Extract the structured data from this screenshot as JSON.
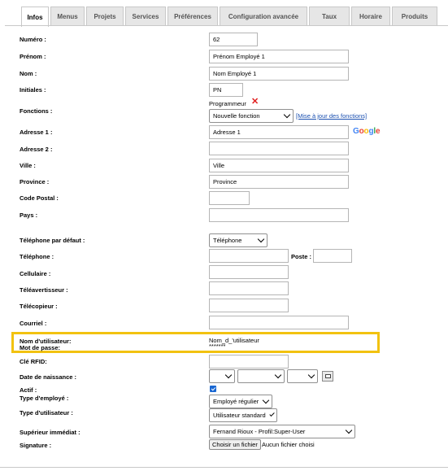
{
  "tabs": [
    {
      "label": "Infos",
      "active": true
    },
    {
      "label": "Menus"
    },
    {
      "label": "Projets"
    },
    {
      "label": "Services"
    },
    {
      "label": "Préférences"
    },
    {
      "label": "Configuration avancée"
    },
    {
      "label": "Taux"
    },
    {
      "label": "Horaire"
    },
    {
      "label": "Produits"
    }
  ],
  "labels": {
    "numero": "Numéro :",
    "prenom": "Prénom :",
    "nom": "Nom :",
    "initiales": "Initiales :",
    "fonctions": "Fonctions :",
    "adresse1": "Adresse 1 :",
    "adresse2": "Adresse 2 :",
    "ville": "Ville :",
    "province": "Province :",
    "code_postal": "Code Postal :",
    "pays": "Pays :",
    "telephone_defaut": "Téléphone par défaut :",
    "telephone": "Téléphone :",
    "poste": "Poste :",
    "cellulaire": "Cellulaire :",
    "teleavertisseur": "Téléavertisseur :",
    "telecopieur": "Télécopieur :",
    "courriel": "Courriel :",
    "nom_utilisateur": "Nom d'utilisateur:",
    "mot_de_passe": "Mot de passe:",
    "cle_rfid": "Clé RFID:",
    "date_naissance": "Date de naissance :",
    "actif": "Actif :",
    "type_employe": "Type d'employé :",
    "type_utilisateur": "Type d'utilisateur :",
    "superieur": "Supérieur immédiat :",
    "signature": "Signature :"
  },
  "values": {
    "numero": "62",
    "prenom": "Prénom Employé 1",
    "nom": "Nom Employé 1",
    "initiales": "PN",
    "fonction_existante": "Programmeur",
    "fonction_select": "Nouvelle fonction",
    "mise_a_jour_link": "[Mise à jour des fonctions]",
    "adresse1": "Adresse 1",
    "adresse2": "",
    "ville": "Ville",
    "province": "Province",
    "code_postal": "",
    "pays": "",
    "telephone_defaut": "Téléphone",
    "telephone": "",
    "poste": "",
    "cellulaire": "",
    "teleavertisseur": "",
    "telecopieur": "",
    "courriel": "",
    "nom_utilisateur": "Nom_d_'utilisateur",
    "mot_de_passe": "*******",
    "cle_rfid": "",
    "actif_checked": true,
    "type_employe": "Employé régulier",
    "type_utilisateur": "Utilisateur standard",
    "superieur": "Fernand Rioux - Profil:Super-User",
    "file_button": "Choisir un fichier",
    "file_none": "Aucun fichier choisi"
  },
  "google_logo": [
    "G",
    "o",
    "o",
    "g",
    "l",
    "e"
  ],
  "colors": {
    "highlight": "#f2c210",
    "remove_icon": "#e02020",
    "link": "#1a4fb0",
    "checkbox": "#1967d2"
  }
}
